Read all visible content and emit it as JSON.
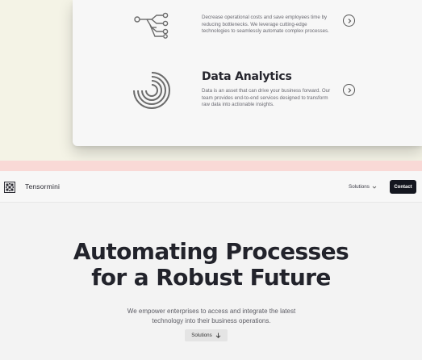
{
  "features": [
    {
      "icon": "network-nodes-icon",
      "title": "",
      "description": "Decrease operational costs and save employees time by reducing bottlenecks. We leverage cutting-edge technologies to seamlessly automate complex processes."
    },
    {
      "icon": "concentric-arcs-icon",
      "title": "Data Analytics",
      "description": "Data is an asset that can drive your business forward. Our team provides end-to-end services designed to transform raw data into actionable insights."
    }
  ],
  "nav": {
    "brand": "Tensormini",
    "solutions_label": "Solutions",
    "contact_label": "Contact"
  },
  "hero": {
    "title_line1": "Automating Processes",
    "title_line2": "for a Robust Future",
    "subtitle": "We empower enterprises to access and integrate the latest technology into their business operations.",
    "button_label": "Solutions"
  },
  "colors": {
    "top_band": "#f4f3e6",
    "pink_band": "#f9d9d6",
    "contact_bg": "#14161f"
  }
}
